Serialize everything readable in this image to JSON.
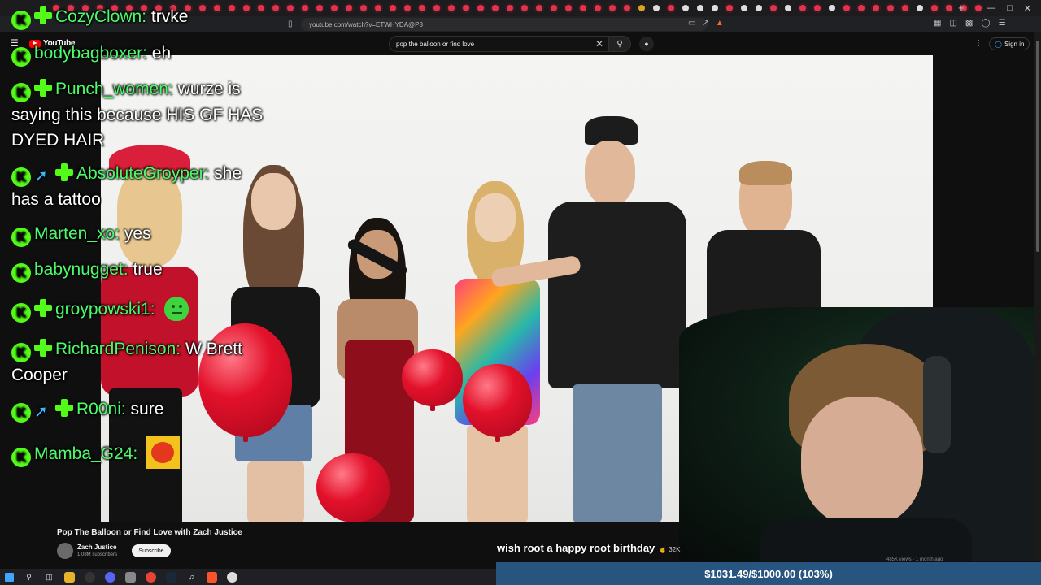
{
  "browser": {
    "url": "youtube.com/watch?v=ETWHYDA@P8"
  },
  "youtube": {
    "logo_text": "YouTube",
    "search_query": "pop the balloon or find love",
    "signin_label": "Sign in"
  },
  "chat": [
    {
      "user": "CozyClown:",
      "text": "trvke",
      "badges": [
        "kick",
        "plus"
      ]
    },
    {
      "user": "bodybagboxer:",
      "text": "eh",
      "badges": [
        "kick"
      ]
    },
    {
      "user": "Punch_women:",
      "text": "wurze is",
      "line2": "saying this because HIS GF HAS",
      "line3": "DYED HAIR",
      "badges": [
        "kick",
        "plus"
      ]
    },
    {
      "user": "AbsoluteGroyper:",
      "text": "she",
      "line2": "has a tattoo",
      "badges": [
        "kick",
        "sword",
        "plus"
      ]
    },
    {
      "user": "Marten_xo:",
      "text": "yes",
      "badges": [
        "kick"
      ]
    },
    {
      "user": "babynugget:",
      "text": "true",
      "badges": [
        "kick"
      ]
    },
    {
      "user": "groypowski1:",
      "text": "",
      "badges": [
        "kick",
        "plus"
      ],
      "emote": "green-blob-emote"
    },
    {
      "user": "RichardPenison:",
      "text": "W Brett",
      "line2": "Cooper",
      "badges": [
        "kick",
        "plus"
      ]
    },
    {
      "user": "R00ni:",
      "text": "sure",
      "badges": [
        "kick",
        "sword",
        "plus"
      ]
    },
    {
      "user": "Mamba_G24:",
      "text": "",
      "badges": [
        "kick"
      ],
      "emote": "boom-emote"
    }
  ],
  "video": {
    "title": "Pop The Balloon or Find Love with Zach Justice",
    "channel": "Zach Justice",
    "subscribers": "1.08M subscribers",
    "subscribe_label": "Subscribe",
    "like_count": "32K",
    "views": "485K views · 1 month ago"
  },
  "tts_message": "wish root a happy root birthday",
  "goal": {
    "text": "$1031.49/$1000.00 (103%)",
    "progress": 1.0
  },
  "colors": {
    "kick_green": "#53fc18",
    "username_green": "#4bfb6a",
    "goal_bar": "#27557f",
    "yt_red": "#ff0000"
  }
}
